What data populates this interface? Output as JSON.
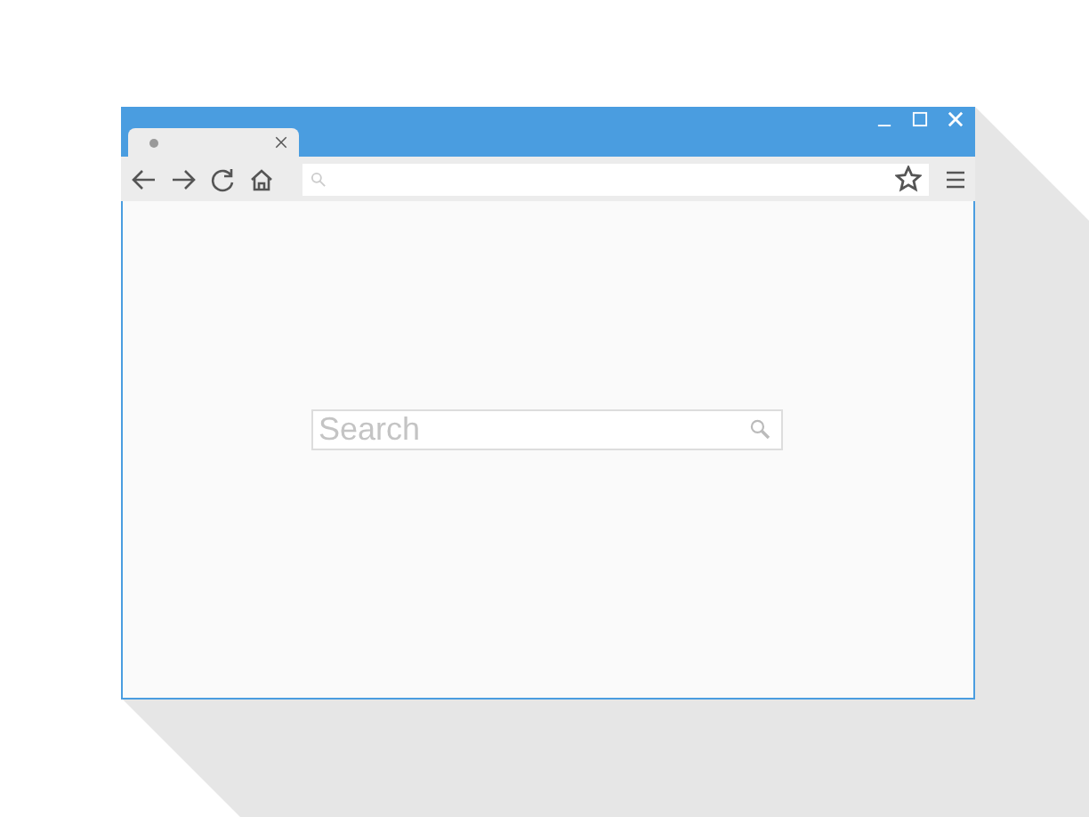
{
  "page": {
    "search": {
      "placeholder": "Search"
    }
  }
}
